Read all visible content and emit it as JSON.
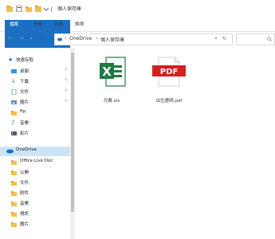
{
  "window": {
    "title": "個人保存庫"
  },
  "ribbon": {
    "tabs": [
      "檔案",
      "常用",
      "共用",
      "檢視"
    ]
  },
  "address": {
    "crumbs": [
      "OneDrive",
      "個人保存庫"
    ],
    "refresh_glyph": "↻"
  },
  "sidebar": {
    "quick_access_label": "快速存取",
    "items": [
      {
        "label": "桌面",
        "icon": "desktop-icon"
      },
      {
        "label": "下載",
        "icon": "download-icon"
      },
      {
        "label": "文件",
        "icon": "document-icon"
      },
      {
        "label": "圖片",
        "icon": "pictures-icon"
      },
      {
        "label": "ftp",
        "icon": "folder-icon"
      },
      {
        "label": "音樂",
        "icon": "music-icon"
      },
      {
        "label": "影片",
        "icon": "video-icon"
      }
    ],
    "onedrive_label": "OneDrive",
    "onedrive_items": [
      {
        "label": "Office Live Doc"
      },
      {
        "label": "公開"
      },
      {
        "label": "文件"
      },
      {
        "label": "附件"
      },
      {
        "label": "音樂"
      },
      {
        "label": "視訊"
      },
      {
        "label": "圖片"
      }
    ]
  },
  "files": [
    {
      "name": "月費.xls",
      "type": "excel",
      "icon_text": "X"
    },
    {
      "name": "出生證明.pdf",
      "type": "pdf",
      "icon_text": "PDF"
    }
  ],
  "colors": {
    "accent": "#1a6fc4",
    "excel_green": "#1e7a45",
    "pdf_red": "#d3201f",
    "folder_yellow": "#f2c14a",
    "selected_bg": "#cce4f7"
  }
}
